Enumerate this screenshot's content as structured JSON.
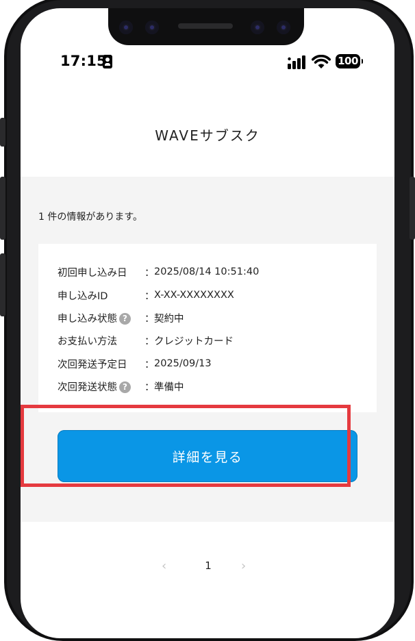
{
  "status_bar": {
    "time": "17:15",
    "battery": "100"
  },
  "header": {
    "title": "WAVEサブスク"
  },
  "content": {
    "result_count": "1 件の情報があります。",
    "rows": [
      {
        "label": "初回申し込み日",
        "colon": "：",
        "value": "2025/08/14 10:51:40",
        "help": false
      },
      {
        "label": "申し込みID",
        "colon": "：",
        "value": "X-XX-XXXXXXXX",
        "help": false
      },
      {
        "label": "申し込み状態",
        "colon": "：",
        "value": "契約中",
        "help": true
      },
      {
        "label": "お支払い方法",
        "colon": "：",
        "value": "クレジットカード",
        "help": false
      },
      {
        "label": "次回発送予定日",
        "colon": "：",
        "value": "2025/09/13",
        "help": false
      },
      {
        "label": "次回発送状態",
        "colon": "：",
        "value": "準備中",
        "help": true
      }
    ],
    "help_glyph": "?",
    "detail_button_label": "詳細を見る"
  },
  "pagination": {
    "prev": "‹",
    "current_page": "1",
    "next": "›"
  },
  "colors": {
    "button": "#0a96e6",
    "highlight": "#e53a3f",
    "content_background": "#f4f4f4"
  }
}
